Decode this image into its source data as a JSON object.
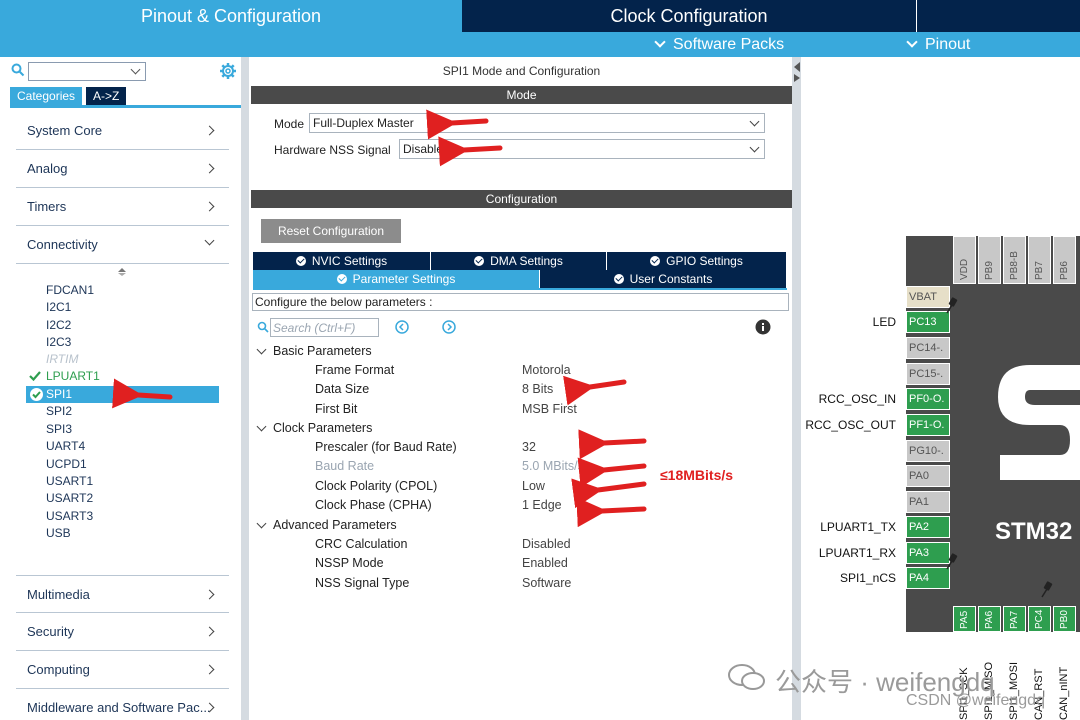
{
  "top_tabs": {
    "pinout": "Pinout & Configuration",
    "clock": "Clock Configuration"
  },
  "sub_menu": {
    "software_packs": "Software Packs",
    "pinout": "Pinout"
  },
  "left": {
    "tabs": {
      "categories": "Categories",
      "az": "A->Z"
    },
    "categories": [
      {
        "label": "System Core"
      },
      {
        "label": "Analog"
      },
      {
        "label": "Timers"
      },
      {
        "label": "Connectivity"
      },
      {
        "label": "Multimedia"
      },
      {
        "label": "Security"
      },
      {
        "label": "Computing"
      },
      {
        "label": "Middleware and Software Pac..."
      }
    ],
    "peripherals": [
      "FDCAN1",
      "I2C1",
      "I2C2",
      "I2C3",
      "IRTIM",
      "LPUART1",
      "SPI1",
      "SPI2",
      "SPI3",
      "UART4",
      "UCPD1",
      "USART1",
      "USART2",
      "USART3",
      "USB"
    ]
  },
  "mid": {
    "title": "SPI1 Mode and Configuration",
    "mode_bar": "Mode",
    "mode_label": "Mode",
    "mode_value": "Full-Duplex Master",
    "nss_label": "Hardware NSS Signal",
    "nss_value": "Disable",
    "config_bar": "Configuration",
    "reset_label": "Reset Configuration",
    "settings_tabs": {
      "nvic": "NVIC Settings",
      "dma": "DMA Settings",
      "gpio": "GPIO Settings",
      "param": "Parameter Settings",
      "user": "User Constants"
    },
    "hint": "Configure the below parameters :",
    "search_placeholder": "Search (Ctrl+F)",
    "groups": {
      "basic": "Basic Parameters",
      "clock": "Clock Parameters",
      "advanced": "Advanced Parameters"
    },
    "params": {
      "frame_format": {
        "name": "Frame Format",
        "value": "Motorola"
      },
      "data_size": {
        "name": "Data Size",
        "value": "8 Bits"
      },
      "first_bit": {
        "name": "First Bit",
        "value": "MSB First"
      },
      "prescaler": {
        "name": "Prescaler (for Baud Rate)",
        "value": "32"
      },
      "baud_rate": {
        "name": "Baud Rate",
        "value": "5.0 MBits/s"
      },
      "cpol": {
        "name": "Clock Polarity (CPOL)",
        "value": "Low"
      },
      "cpha": {
        "name": "Clock Phase (CPHA)",
        "value": "1 Edge"
      },
      "crc": {
        "name": "CRC Calculation",
        "value": "Disabled"
      },
      "nssp": {
        "name": "NSSP Mode",
        "value": "Enabled"
      },
      "nss_type": {
        "name": "NSS Signal Type",
        "value": "Software"
      }
    },
    "annotation": "≤18MBits/s"
  },
  "chip": {
    "name": "STM32",
    "top_pins": [
      "VDD",
      "PB9",
      "PB8-B",
      "PB7",
      "PB6"
    ],
    "left_pins": [
      "VBAT",
      "PC13",
      "PC14-.",
      "PC15-.",
      "PF0-O.",
      "PF1-O.",
      "PG10-.",
      "PA0",
      "PA1",
      "PA2",
      "PA3",
      "PA4"
    ],
    "left_signals": {
      "pc13": "LED",
      "pf0": "RCC_OSC_IN",
      "pf1": "RCC_OSC_OUT",
      "pa2": "LPUART1_TX",
      "pa3": "LPUART1_RX",
      "pa4": "SPI1_nCS"
    },
    "bottom_pins": [
      "PA5",
      "PA6",
      "PA7",
      "PC4",
      "PB0"
    ],
    "bottom_signals": [
      "SPI1_SCK",
      "SPI1_MISO",
      "SPI1_MOSI",
      "CAN_RST",
      "CAN_nINT"
    ]
  },
  "watermark": {
    "wechat": "公众号 · weifengdq",
    "csdn": "CSDN @weifengdq"
  },
  "colors": {
    "accent": "#39a9dc",
    "navy": "#03234b",
    "pin_green": "#2e9e4f",
    "annotation_red": "#e02020"
  }
}
